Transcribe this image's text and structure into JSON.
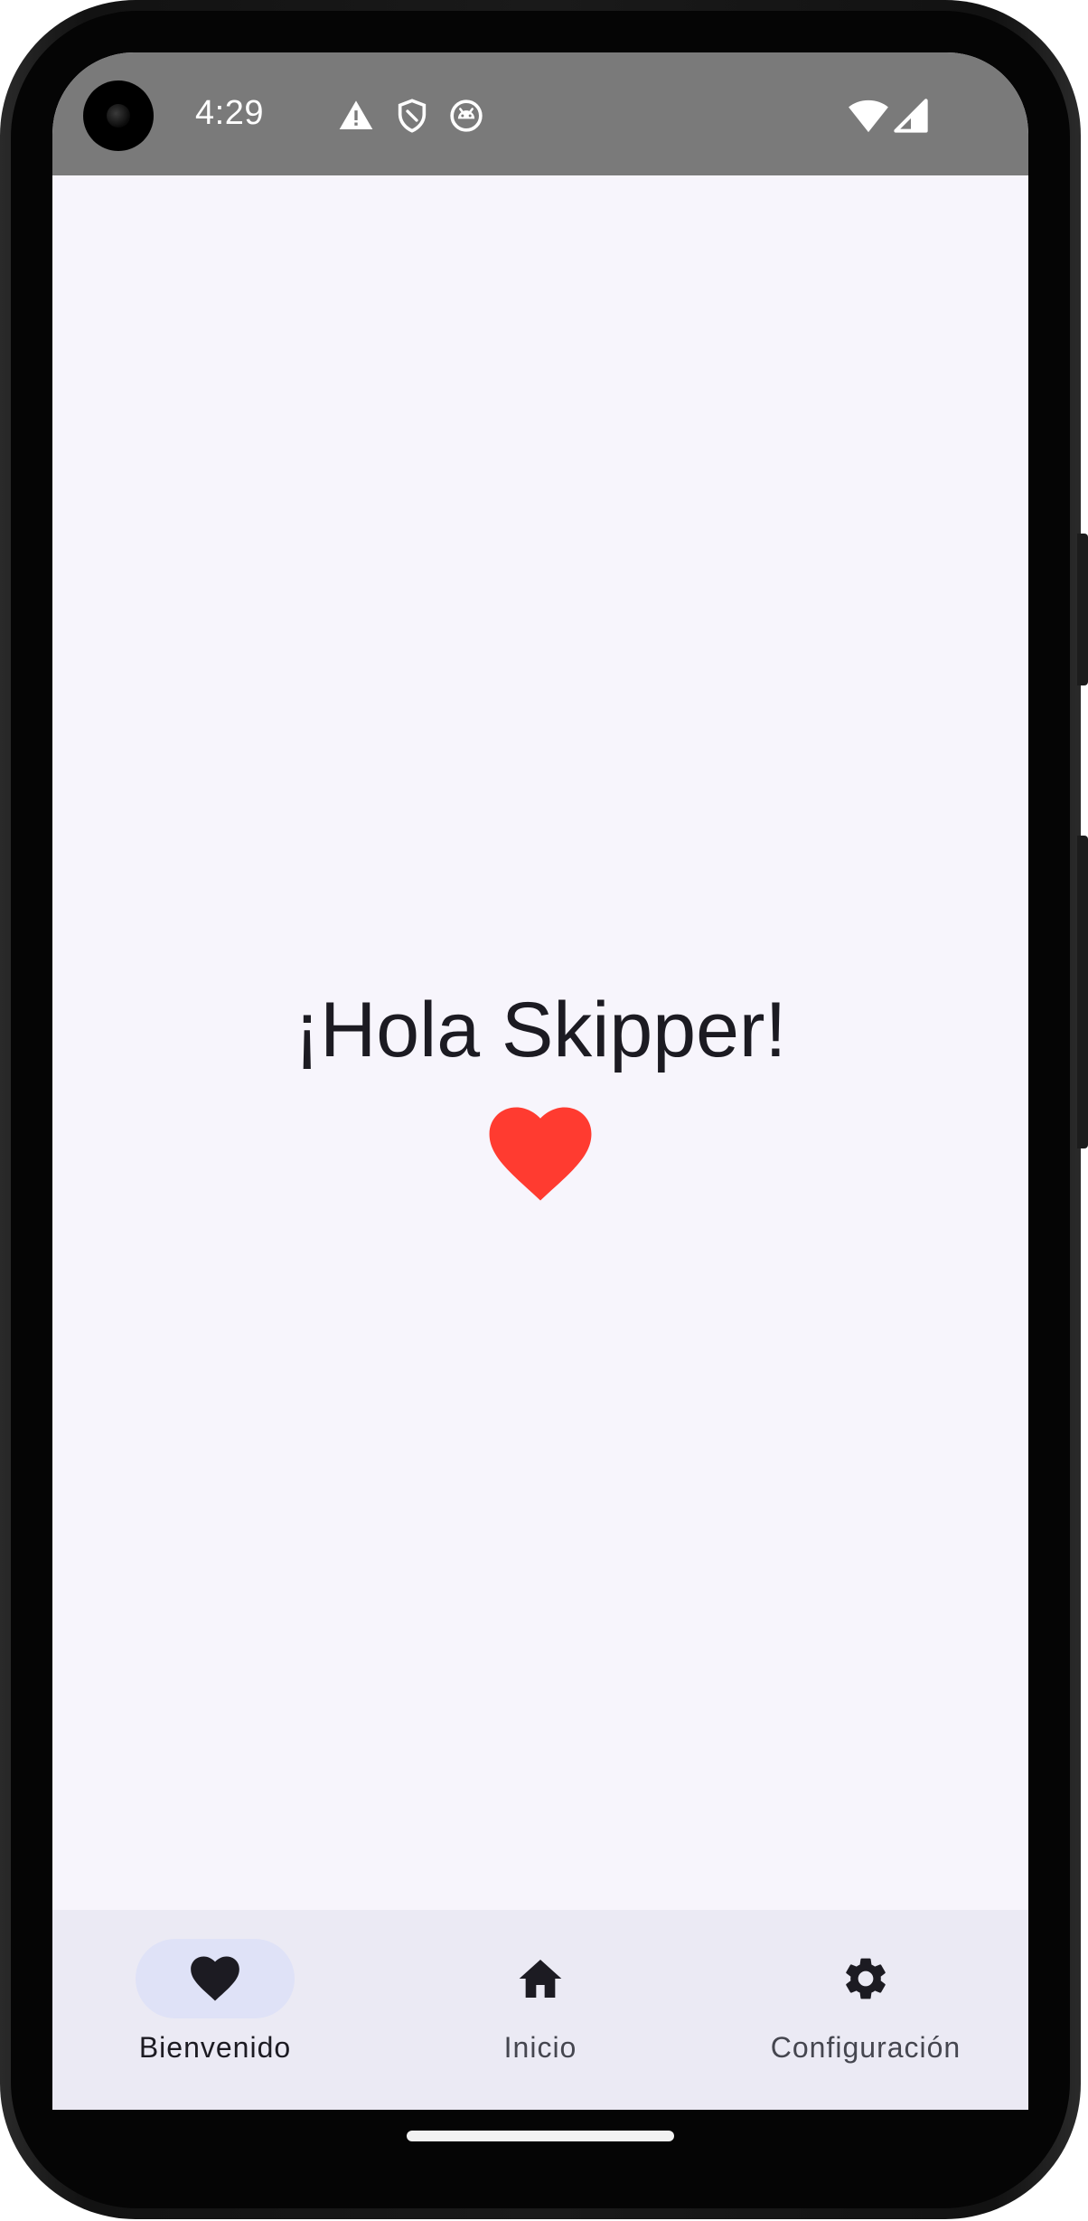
{
  "status_bar": {
    "time": "4:29",
    "icons": [
      "warning-icon",
      "shield-icon",
      "android-debug-icon"
    ],
    "right_icons": [
      "wifi-icon",
      "cell-signal-icon"
    ]
  },
  "main": {
    "greeting": "¡Hola Skipper!",
    "heart_icon": "heart-icon",
    "heart_color": "#ff3b30"
  },
  "nav": {
    "items": [
      {
        "label": "Bienvenido",
        "icon": "heart-icon",
        "active": true
      },
      {
        "label": "Inicio",
        "icon": "home-icon",
        "active": false
      },
      {
        "label": "Configuración",
        "icon": "gear-icon",
        "active": false
      }
    ]
  },
  "colors": {
    "background": "#f7f5fc",
    "navbar": "#ebeaf4",
    "active_pill": "#dfe2f7",
    "status_bar": "#7a7a7a"
  }
}
